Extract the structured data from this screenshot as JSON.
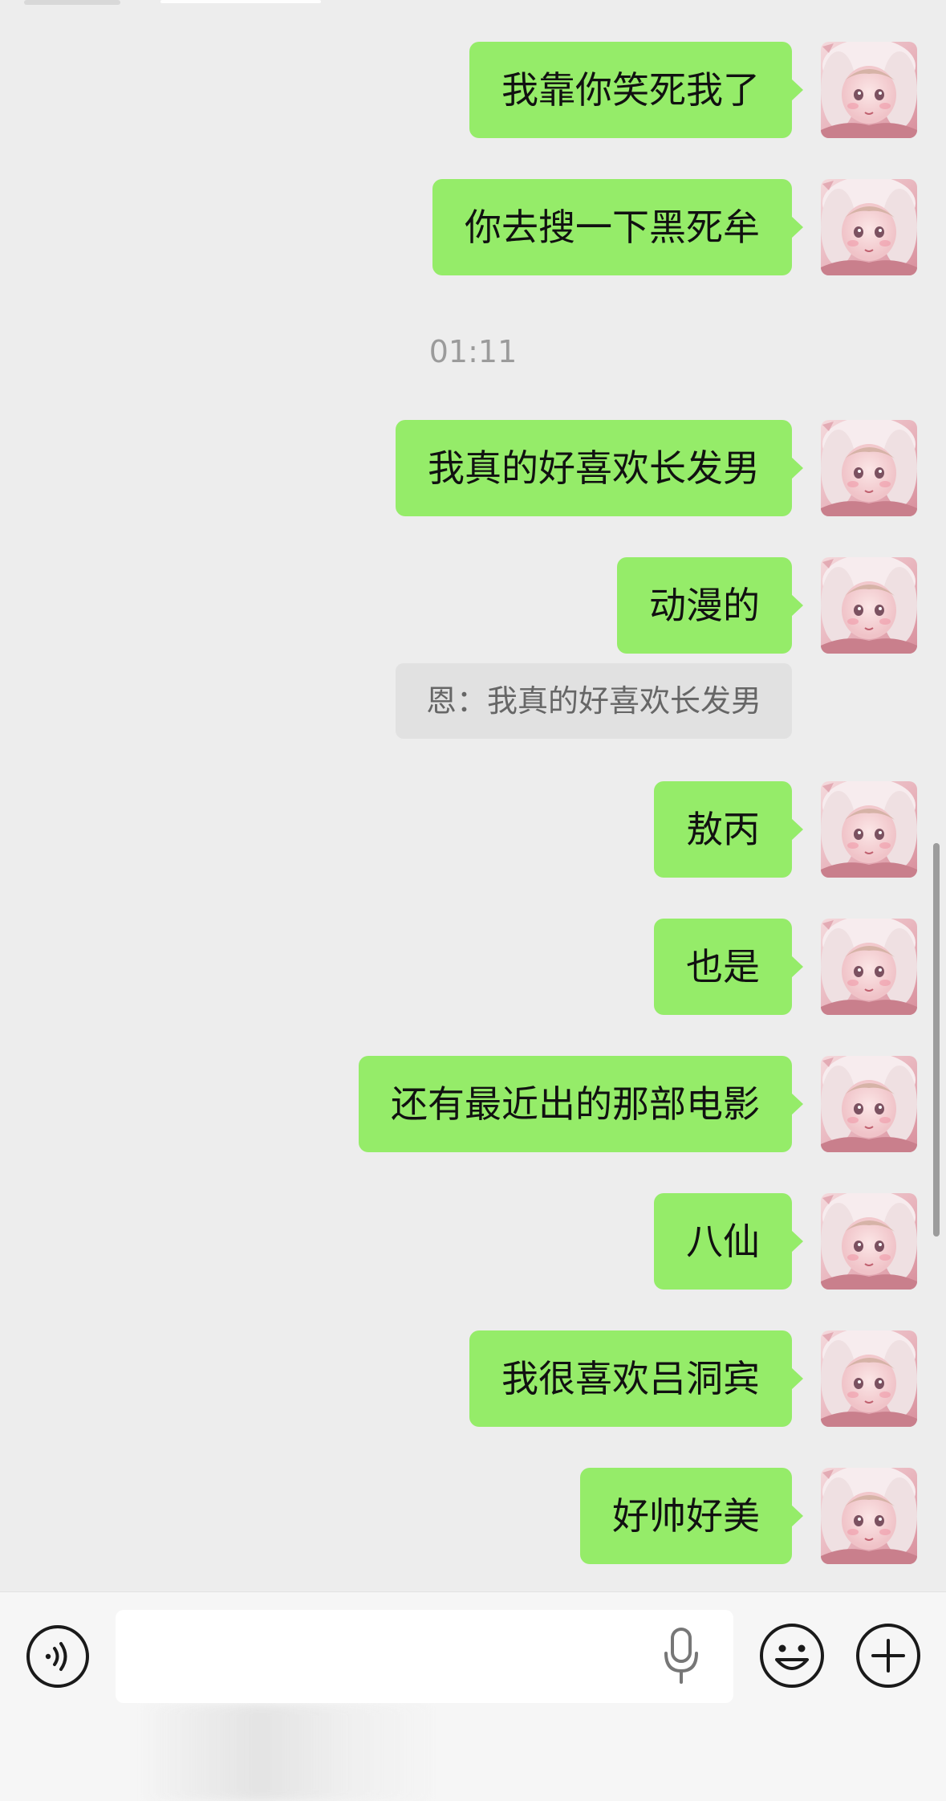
{
  "chat": {
    "messages": [
      {
        "text": "我靠你笑死我了"
      },
      {
        "text": "你去搜一下黑死牟"
      },
      {
        "text": "我真的好喜欢长发男"
      },
      {
        "text": "动漫的"
      },
      {
        "text": "敖丙"
      },
      {
        "text": "也是"
      },
      {
        "text": "还有最近出的那部电影"
      },
      {
        "text": "八仙"
      },
      {
        "text": "我很喜欢吕洞宾"
      },
      {
        "text": "好帅好美"
      }
    ],
    "timestamp": "01:11",
    "quote": "恩：我真的好喜欢长发男"
  },
  "input_bar": {
    "text_value": "",
    "icons": {
      "voice": "voice-mode-icon",
      "mic": "microphone-icon",
      "emoji": "emoji-icon",
      "plus": "plus-icon"
    }
  },
  "colors": {
    "bubble": "#95ec69",
    "background": "#ededed",
    "quote_bg": "#e1e1e1",
    "input_bar_bg": "#f6f6f6"
  }
}
